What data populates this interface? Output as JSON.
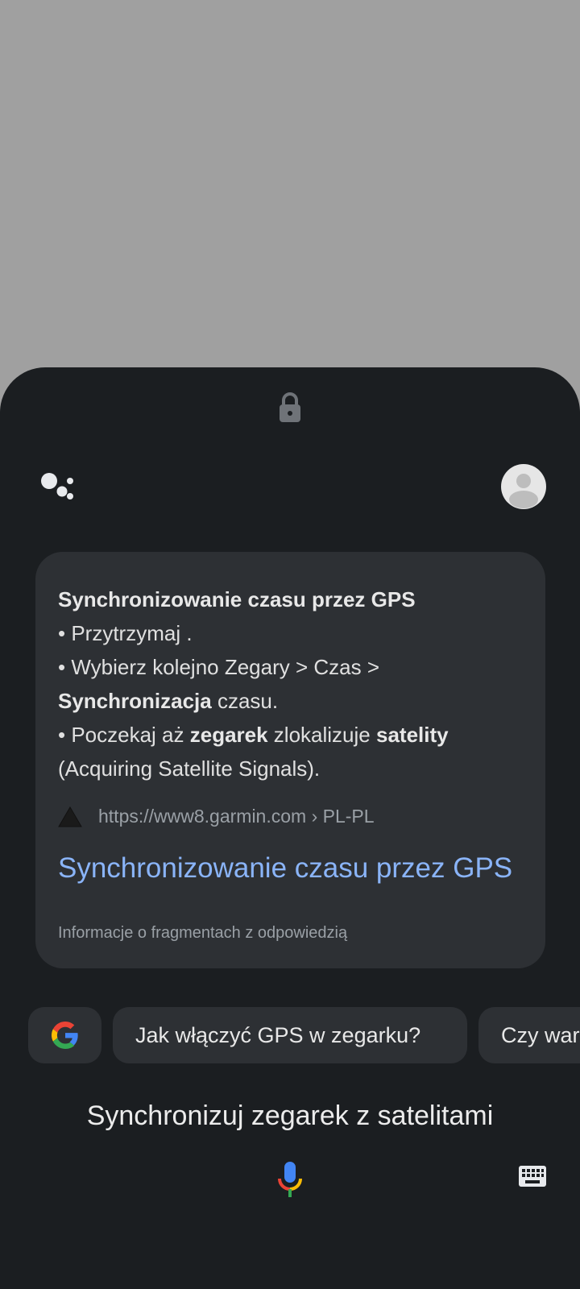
{
  "answer": {
    "title": "Synchronizowanie czasu przez GPS",
    "step1": "• Przytrzymaj .",
    "step2": "• Wybierz kolejno Zegary > Czas >",
    "step2_bold": "Synchronizacja",
    "step2_rest": " czasu.",
    "step3_a": "• Poczekaj aż ",
    "step3_bold1": "zegarek",
    "step3_b": " zlokalizuje ",
    "step3_bold2": "satelity",
    "step3_c": "(Acquiring Satellite Signals)."
  },
  "source": {
    "url": "https://www8.garmin.com › PL-PL",
    "icon": "garmin-triangle-icon"
  },
  "result": {
    "link_text": "Synchronizowanie czasu przez GPS"
  },
  "snippet_info": "Informacje o fragmentach z odpowiedzią",
  "suggestions": [
    "Jak włączyć GPS w zegarku?",
    "Czy war"
  ],
  "query": "Synchronizuj zegarek z satelitami",
  "colors": {
    "sheet_bg": "#1b1e21",
    "card_bg": "#2d3034",
    "link": "#8ab4f8",
    "scrim": "#a0a0a0"
  }
}
